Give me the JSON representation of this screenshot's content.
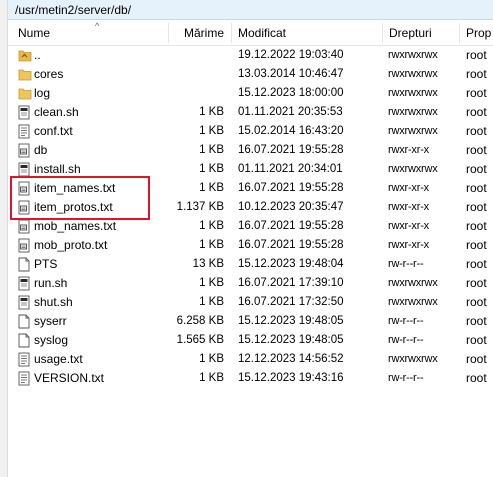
{
  "path": "/usr/metin2/server/db/",
  "columns": {
    "name": "Nume",
    "size": "Mărime",
    "modified": "Modificat",
    "rights": "Drepturi",
    "owner": "Prop"
  },
  "files": [
    {
      "name": "..",
      "size": "",
      "modified": "19.12.2022 19:03:40",
      "rights": "rwxrwxrwx",
      "owner": "root",
      "icon": "parent-folder-icon"
    },
    {
      "name": "cores",
      "size": "",
      "modified": "13.03.2014 10:46:47",
      "rights": "rwxrwxrwx",
      "owner": "root",
      "icon": "folder-icon"
    },
    {
      "name": "log",
      "size": "",
      "modified": "15.12.2023 18:00:00",
      "rights": "rwxrwxrwx",
      "owner": "root",
      "icon": "folder-icon"
    },
    {
      "name": "clean.sh",
      "size": "1 KB",
      "modified": "01.11.2021 20:35:53",
      "rights": "rwxrwxrwx",
      "owner": "root",
      "icon": "script-file-icon"
    },
    {
      "name": "conf.txt",
      "size": "1 KB",
      "modified": "15.02.2014 16:43:20",
      "rights": "rwxrwxrwx",
      "owner": "root",
      "icon": "text-file-icon"
    },
    {
      "name": "db",
      "size": "1 KB",
      "modified": "16.07.2021 19:55:28",
      "rights": "rwxr-xr-x",
      "owner": "root",
      "icon": "binary-file-icon"
    },
    {
      "name": "install.sh",
      "size": "1 KB",
      "modified": "01.11.2021 20:34:01",
      "rights": "rwxrwxrwx",
      "owner": "root",
      "icon": "script-file-icon"
    },
    {
      "name": "item_names.txt",
      "size": "1 KB",
      "modified": "16.07.2021 19:55:28",
      "rights": "rwxr-xr-x",
      "owner": "root",
      "icon": "binary-file-icon"
    },
    {
      "name": "item_protos.txt",
      "size": "1.137 KB",
      "modified": "10.12.2023 20:35:47",
      "rights": "rwxr-xr-x",
      "owner": "root",
      "icon": "binary-file-icon"
    },
    {
      "name": "mob_names.txt",
      "size": "1 KB",
      "modified": "16.07.2021 19:55:28",
      "rights": "rwxr-xr-x",
      "owner": "root",
      "icon": "binary-file-icon"
    },
    {
      "name": "mob_proto.txt",
      "size": "1 KB",
      "modified": "16.07.2021 19:55:28",
      "rights": "rwxr-xr-x",
      "owner": "root",
      "icon": "binary-file-icon"
    },
    {
      "name": "PTS",
      "size": "13 KB",
      "modified": "15.12.2023 19:48:04",
      "rights": "rw-r--r--",
      "owner": "root",
      "icon": "blank-file-icon"
    },
    {
      "name": "run.sh",
      "size": "1 KB",
      "modified": "16.07.2021 17:39:10",
      "rights": "rwxrwxrwx",
      "owner": "root",
      "icon": "script-file-icon"
    },
    {
      "name": "shut.sh",
      "size": "1 KB",
      "modified": "16.07.2021 17:32:50",
      "rights": "rwxrwxrwx",
      "owner": "root",
      "icon": "script-file-icon"
    },
    {
      "name": "syserr",
      "size": "6.258 KB",
      "modified": "15.12.2023 19:48:05",
      "rights": "rw-r--r--",
      "owner": "root",
      "icon": "blank-file-icon"
    },
    {
      "name": "syslog",
      "size": "1.565 KB",
      "modified": "15.12.2023 19:48:05",
      "rights": "rw-r--r--",
      "owner": "root",
      "icon": "blank-file-icon"
    },
    {
      "name": "usage.txt",
      "size": "1 KB",
      "modified": "12.12.2023 14:56:52",
      "rights": "rwxrwxrwx",
      "owner": "root",
      "icon": "text-file-icon"
    },
    {
      "name": "VERSION.txt",
      "size": "1 KB",
      "modified": "15.12.2023 19:43:16",
      "rights": "rw-r--r--",
      "owner": "root",
      "icon": "text-file-icon"
    }
  ],
  "colors": {
    "path_bg": "#e5f1fb",
    "folder": "#e8b84a",
    "highlight": "#e0142a"
  }
}
